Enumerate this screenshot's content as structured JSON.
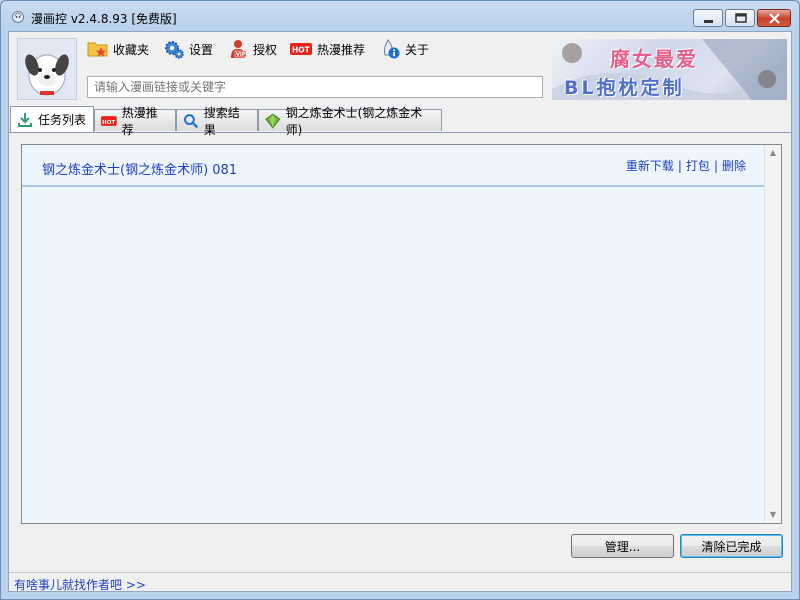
{
  "window": {
    "title": "漫画控 v2.4.8.93 [免费版]"
  },
  "toolbar": {
    "items": [
      {
        "label": "收藏夹",
        "icon": "folder-star-icon"
      },
      {
        "label": "设置",
        "icon": "gears-icon"
      },
      {
        "label": "授权",
        "icon": "vip-icon"
      },
      {
        "label": "热漫推荐",
        "icon": "hot-icon"
      },
      {
        "label": "关于",
        "icon": "info-icon"
      }
    ]
  },
  "search": {
    "placeholder": "请输入漫画链接或关键字",
    "value": ""
  },
  "banner": {
    "line1": "腐女最爱",
    "line2": "BL抱枕定制"
  },
  "tabs": [
    {
      "label": "任务列表",
      "icon": "download-icon",
      "active": true
    },
    {
      "label": "热漫推荐",
      "icon": "hot-icon",
      "active": false
    },
    {
      "label": "搜索结果",
      "icon": "search-icon",
      "active": false
    },
    {
      "label": "钢之炼金术士(钢之炼金术师)",
      "icon": "book-icon",
      "active": false
    }
  ],
  "tasks": [
    {
      "title": "钢之炼金术士(钢之炼金术师) 081",
      "actions": [
        "重新下载",
        "打包",
        "删除"
      ]
    }
  ],
  "buttons": {
    "manage": "管理...",
    "clear_done": "清除已完成"
  },
  "status": {
    "link": "有啥事儿就找作者吧 >>"
  },
  "colors": {
    "link": "#1e3fc7",
    "task_bg": "#eef6fd",
    "frame": "#b9d1ea"
  }
}
